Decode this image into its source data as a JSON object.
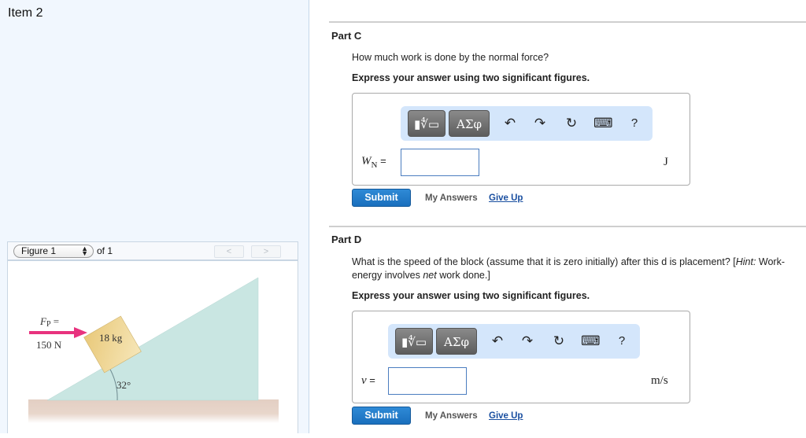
{
  "item": {
    "title": "Item 2"
  },
  "figure": {
    "selector_value": "Figure 1",
    "of_label": "of 1",
    "prev_glyph": "<",
    "next_glyph": ">",
    "force_label": "F",
    "force_subscript": "P",
    "force_equals": " =",
    "force_value": "150 N",
    "mass_label": "18 kg",
    "angle_label": "32°",
    "colors": {
      "arrow": "#e8327e",
      "incline": "#c9e6e2",
      "block": "#ecd08a",
      "ground": "#e5d2c6"
    }
  },
  "parts": [
    {
      "title": "Part C",
      "question": "How much work is done by the normal force?",
      "instruction": "Express your answer using two significant figures.",
      "toolbar": {
        "template_glyph": "▮∜▭",
        "greek_label": "ΑΣφ",
        "undo_icon": "↶",
        "redo_icon": "↷",
        "reset_icon": "↻",
        "keyboard_icon": "⌨",
        "help_label": "?"
      },
      "variable": "W",
      "variable_subscript": "N",
      "equals": " =",
      "input_value": "",
      "unit": "J",
      "submit_label": "Submit",
      "my_answers_label": "My Answers",
      "give_up_label": "Give Up"
    },
    {
      "title": "Part D",
      "question_prefix": "What is the speed of the block (assume that it is zero initially) after this d is placement? [",
      "question_hint": "Hint:",
      "question_mid": " Work-energy involves ",
      "question_net": "net",
      "question_suffix": " work done.]",
      "instruction": "Express your answer using two significant figures.",
      "toolbar": {
        "template_glyph": "▮∜▭",
        "greek_label": "ΑΣφ",
        "undo_icon": "↶",
        "redo_icon": "↷",
        "reset_icon": "↻",
        "keyboard_icon": "⌨",
        "help_label": "?"
      },
      "variable": "v",
      "equals": " =",
      "input_value": "",
      "unit": "m/s",
      "submit_label": "Submit",
      "my_answers_label": "My Answers",
      "give_up_label": "Give Up"
    }
  ]
}
